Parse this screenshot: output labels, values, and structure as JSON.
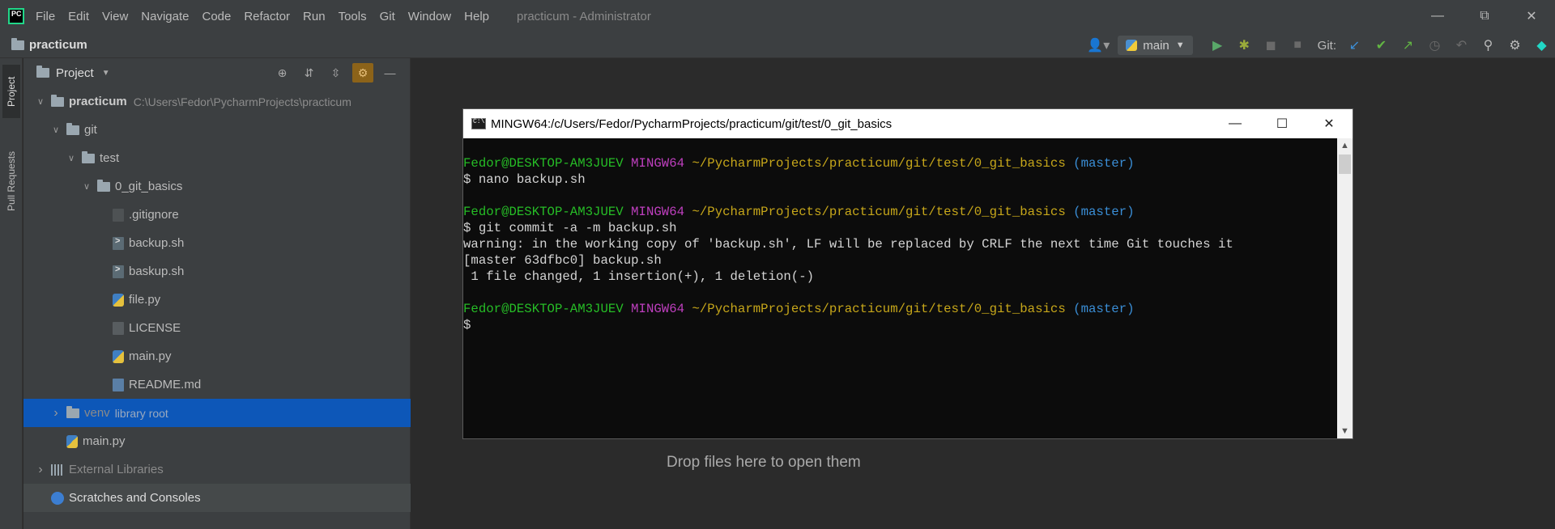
{
  "app": {
    "logo_text": "PC",
    "menu": [
      "File",
      "Edit",
      "View",
      "Navigate",
      "Code",
      "Refactor",
      "Run",
      "Tools",
      "Git",
      "Window",
      "Help"
    ],
    "window_title": "practicum - Administrator"
  },
  "navbar": {
    "project_name": "practicum",
    "run_config": "main",
    "git_label": "Git:"
  },
  "stripe": {
    "project_tab": "Project",
    "pull_requests_tab": "Pull Requests"
  },
  "project_panel": {
    "title": "Project",
    "tree": [
      {
        "name": "practicum",
        "path": "C:\\Users\\Fedor\\PycharmProjects\\practicum",
        "icon": "folder-icon",
        "expanded": true
      },
      {
        "name": "git",
        "icon": "folder-icon",
        "expanded": true
      },
      {
        "name": "test",
        "icon": "folder-icon",
        "expanded": true
      },
      {
        "name": "0_git_basics",
        "icon": "folder-icon",
        "expanded": true
      },
      {
        "name": ".gitignore",
        "icon": "gitignore-file-icon"
      },
      {
        "name": "backup.sh",
        "icon": "shell-file-icon"
      },
      {
        "name": "baskup.sh",
        "icon": "shell-file-icon"
      },
      {
        "name": "file.py",
        "icon": "python-file-icon"
      },
      {
        "name": "LICENSE",
        "icon": "text-file-icon"
      },
      {
        "name": "main.py",
        "icon": "python-file-icon"
      },
      {
        "name": "README.md",
        "icon": "markdown-file-icon"
      },
      {
        "name": "venv",
        "suffix": "library root",
        "icon": "folder-icon",
        "expanded": false,
        "selected": true
      },
      {
        "name": "main.py",
        "icon": "python-file-icon"
      },
      {
        "name": "External Libraries",
        "icon": "library-icon",
        "expanded": false
      },
      {
        "name": "Scratches and Consoles",
        "icon": "scratch-icon"
      }
    ]
  },
  "editor": {
    "drop_hint": "Drop files here to open them"
  },
  "terminal": {
    "title": "MINGW64:/c/Users/Fedor/PycharmProjects/practicum/git/test/0_git_basics",
    "prompt": {
      "user": "Fedor@DESKTOP-AM3JUEV",
      "host": "MINGW64",
      "path": "~/PycharmProjects/practicum/git/test/0_git_basics",
      "branch": "(master)"
    },
    "cmd1": "$ nano backup.sh",
    "cmd2": "$ git commit -a -m backup.sh",
    "out1": "warning: in the working copy of 'backup.sh', LF will be replaced by CRLF the next time Git touches it",
    "out2": "[master 63dfbc0] backup.sh",
    "out3": " 1 file changed, 1 insertion(+), 1 deletion(-)",
    "cmd3": "$"
  },
  "colors": {
    "selection": "#0d57b8",
    "prompt_user": "#26bd26",
    "prompt_host": "#bf3fbf",
    "prompt_path": "#c7a71a",
    "prompt_branch": "#3a8ed6"
  }
}
